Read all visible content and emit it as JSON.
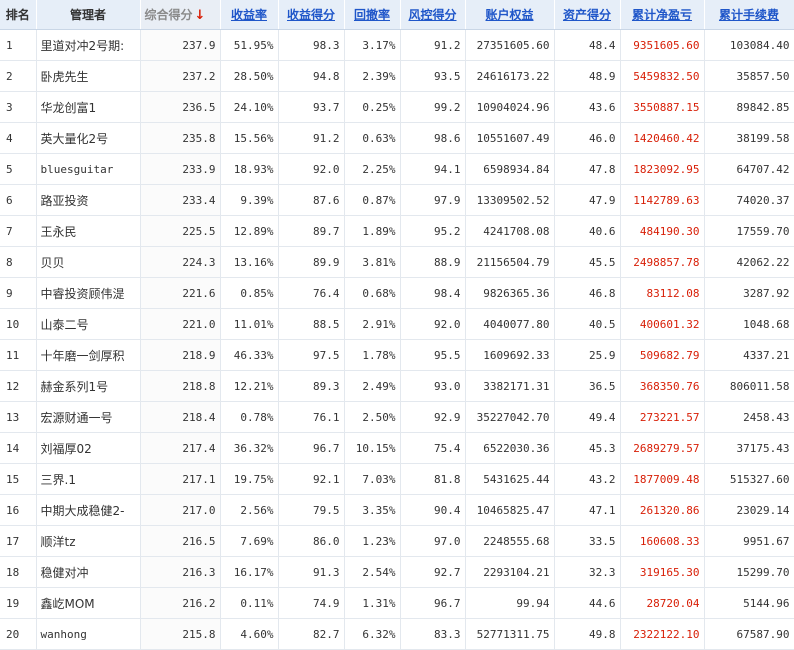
{
  "headers": {
    "rank": "排名",
    "manager": "管理者",
    "composite": "综合得分",
    "sort_arrow": "↓",
    "return_rate": "收益率",
    "return_score": "收益得分",
    "drawdown": "回撤率",
    "risk_score": "风控得分",
    "equity": "账户权益",
    "asset_score": "资产得分",
    "net_pnl": "累计净盈亏",
    "fees": "累计手续费"
  },
  "rows": [
    {
      "rank": "1",
      "manager": "里道对冲2号期:",
      "composite": "237.9",
      "return_rate": "51.95%",
      "return_score": "98.3",
      "drawdown": "3.17%",
      "risk_score": "91.2",
      "equity": "27351605.60",
      "asset_score": "48.4",
      "net_pnl": "9351605.60",
      "fees": "103084.40"
    },
    {
      "rank": "2",
      "manager": "卧虎先生",
      "composite": "237.2",
      "return_rate": "28.50%",
      "return_score": "94.8",
      "drawdown": "2.39%",
      "risk_score": "93.5",
      "equity": "24616173.22",
      "asset_score": "48.9",
      "net_pnl": "5459832.50",
      "fees": "35857.50"
    },
    {
      "rank": "3",
      "manager": "华龙创富1",
      "composite": "236.5",
      "return_rate": "24.10%",
      "return_score": "93.7",
      "drawdown": "0.25%",
      "risk_score": "99.2",
      "equity": "10904024.96",
      "asset_score": "43.6",
      "net_pnl": "3550887.15",
      "fees": "89842.85"
    },
    {
      "rank": "4",
      "manager": "英大量化2号",
      "composite": "235.8",
      "return_rate": "15.56%",
      "return_score": "91.2",
      "drawdown": "0.63%",
      "risk_score": "98.6",
      "equity": "10551607.49",
      "asset_score": "46.0",
      "net_pnl": "1420460.42",
      "fees": "38199.58"
    },
    {
      "rank": "5",
      "manager": "bluesguitar",
      "composite": "233.9",
      "return_rate": "18.93%",
      "return_score": "92.0",
      "drawdown": "2.25%",
      "risk_score": "94.1",
      "equity": "6598934.84",
      "asset_score": "47.8",
      "net_pnl": "1823092.95",
      "fees": "64707.42"
    },
    {
      "rank": "6",
      "manager": "路亚投资",
      "composite": "233.4",
      "return_rate": "9.39%",
      "return_score": "87.6",
      "drawdown": "0.87%",
      "risk_score": "97.9",
      "equity": "13309502.52",
      "asset_score": "47.9",
      "net_pnl": "1142789.63",
      "fees": "74020.37"
    },
    {
      "rank": "7",
      "manager": "王永民",
      "composite": "225.5",
      "return_rate": "12.89%",
      "return_score": "89.7",
      "drawdown": "1.89%",
      "risk_score": "95.2",
      "equity": "4241708.08",
      "asset_score": "40.6",
      "net_pnl": "484190.30",
      "fees": "17559.70"
    },
    {
      "rank": "8",
      "manager": "贝贝",
      "composite": "224.3",
      "return_rate": "13.16%",
      "return_score": "89.9",
      "drawdown": "3.81%",
      "risk_score": "88.9",
      "equity": "21156504.79",
      "asset_score": "45.5",
      "net_pnl": "2498857.78",
      "fees": "42062.22"
    },
    {
      "rank": "9",
      "manager": "中睿投资顾伟湜",
      "composite": "221.6",
      "return_rate": "0.85%",
      "return_score": "76.4",
      "drawdown": "0.68%",
      "risk_score": "98.4",
      "equity": "9826365.36",
      "asset_score": "46.8",
      "net_pnl": "83112.08",
      "fees": "3287.92"
    },
    {
      "rank": "10",
      "manager": "山泰二号",
      "composite": "221.0",
      "return_rate": "11.01%",
      "return_score": "88.5",
      "drawdown": "2.91%",
      "risk_score": "92.0",
      "equity": "4040077.80",
      "asset_score": "40.5",
      "net_pnl": "400601.32",
      "fees": "1048.68"
    },
    {
      "rank": "11",
      "manager": "十年磨一剑厚积",
      "composite": "218.9",
      "return_rate": "46.33%",
      "return_score": "97.5",
      "drawdown": "1.78%",
      "risk_score": "95.5",
      "equity": "1609692.33",
      "asset_score": "25.9",
      "net_pnl": "509682.79",
      "fees": "4337.21"
    },
    {
      "rank": "12",
      "manager": "赫金系列1号",
      "composite": "218.8",
      "return_rate": "12.21%",
      "return_score": "89.3",
      "drawdown": "2.49%",
      "risk_score": "93.0",
      "equity": "3382171.31",
      "asset_score": "36.5",
      "net_pnl": "368350.76",
      "fees": "806011.58"
    },
    {
      "rank": "13",
      "manager": "宏源财通一号",
      "composite": "218.4",
      "return_rate": "0.78%",
      "return_score": "76.1",
      "drawdown": "2.50%",
      "risk_score": "92.9",
      "equity": "35227042.70",
      "asset_score": "49.4",
      "net_pnl": "273221.57",
      "fees": "2458.43"
    },
    {
      "rank": "14",
      "manager": "刘福厚02",
      "composite": "217.4",
      "return_rate": "36.32%",
      "return_score": "96.7",
      "drawdown": "10.15%",
      "risk_score": "75.4",
      "equity": "6522030.36",
      "asset_score": "45.3",
      "net_pnl": "2689279.57",
      "fees": "37175.43"
    },
    {
      "rank": "15",
      "manager": "三界.1",
      "composite": "217.1",
      "return_rate": "19.75%",
      "return_score": "92.1",
      "drawdown": "7.03%",
      "risk_score": "81.8",
      "equity": "5431625.44",
      "asset_score": "43.2",
      "net_pnl": "1877009.48",
      "fees": "515327.60"
    },
    {
      "rank": "16",
      "manager": "中期大成稳健2-",
      "composite": "217.0",
      "return_rate": "2.56%",
      "return_score": "79.5",
      "drawdown": "3.35%",
      "risk_score": "90.4",
      "equity": "10465825.47",
      "asset_score": "47.1",
      "net_pnl": "261320.86",
      "fees": "23029.14"
    },
    {
      "rank": "17",
      "manager": "顺洋tz",
      "composite": "216.5",
      "return_rate": "7.69%",
      "return_score": "86.0",
      "drawdown": "1.23%",
      "risk_score": "97.0",
      "equity": "2248555.68",
      "asset_score": "33.5",
      "net_pnl": "160608.33",
      "fees": "9951.67"
    },
    {
      "rank": "18",
      "manager": "稳健对冲",
      "composite": "216.3",
      "return_rate": "16.17%",
      "return_score": "91.3",
      "drawdown": "2.54%",
      "risk_score": "92.7",
      "equity": "2293104.21",
      "asset_score": "32.3",
      "net_pnl": "319165.30",
      "fees": "15299.70"
    },
    {
      "rank": "19",
      "manager": "鑫屹MOM",
      "composite": "216.2",
      "return_rate": "0.11%",
      "return_score": "74.9",
      "drawdown": "1.31%",
      "risk_score": "96.7",
      "equity": "99.94",
      "asset_score": "44.6",
      "net_pnl": "28720.04",
      "fees": "5144.96"
    },
    {
      "rank": "20",
      "manager": "wanhong",
      "composite": "215.8",
      "return_rate": "4.60%",
      "return_score": "82.7",
      "drawdown": "6.32%",
      "risk_score": "83.3",
      "equity": "52771311.75",
      "asset_score": "49.8",
      "net_pnl": "2322122.10",
      "fees": "67587.90"
    }
  ],
  "colors": {
    "header_bg": "#e6eef8",
    "link_blue": "#1f56c9",
    "profit_red": "#d81e06",
    "text": "#333333"
  }
}
